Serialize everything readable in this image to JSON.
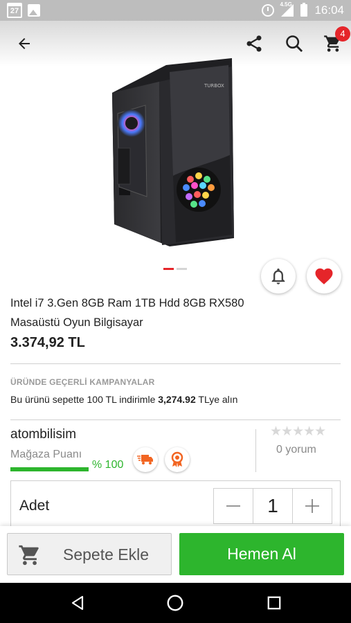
{
  "status_bar": {
    "calendar_day": "27",
    "network": "4.5G",
    "time": "16:04"
  },
  "app_bar": {
    "cart_count": "4"
  },
  "product": {
    "image_icon": "gaming-pc-case-image",
    "title": "Intel i7 3.Gen 8GB Ram 1TB Hdd 8GB RX580 Masaüstü Oyun Bilgisayar",
    "price": "3.374,92 TL",
    "gallery_total": 2,
    "gallery_active_index": 0
  },
  "campaign": {
    "heading": "ÜRÜNDE GEÇERLİ KAMPANYALAR",
    "text_prefix": "Bu ürünü sepette 100 TL indirimle ",
    "text_amount": "3,274.92",
    "text_suffix": " TLye alın"
  },
  "seller": {
    "name": "atombilisim",
    "score_label": "Mağaza Puanı",
    "score_value": "% 100",
    "score_fraction": 1.0,
    "rating_stars": 0,
    "reviews": "0 yorum"
  },
  "quantity": {
    "label": "Adet",
    "value": "1"
  },
  "actions": {
    "add_to_cart": "Sepete Ekle",
    "buy_now": "Hemen Al"
  },
  "colors": {
    "accent_red": "#e5252a",
    "accent_green": "#2db52d"
  }
}
